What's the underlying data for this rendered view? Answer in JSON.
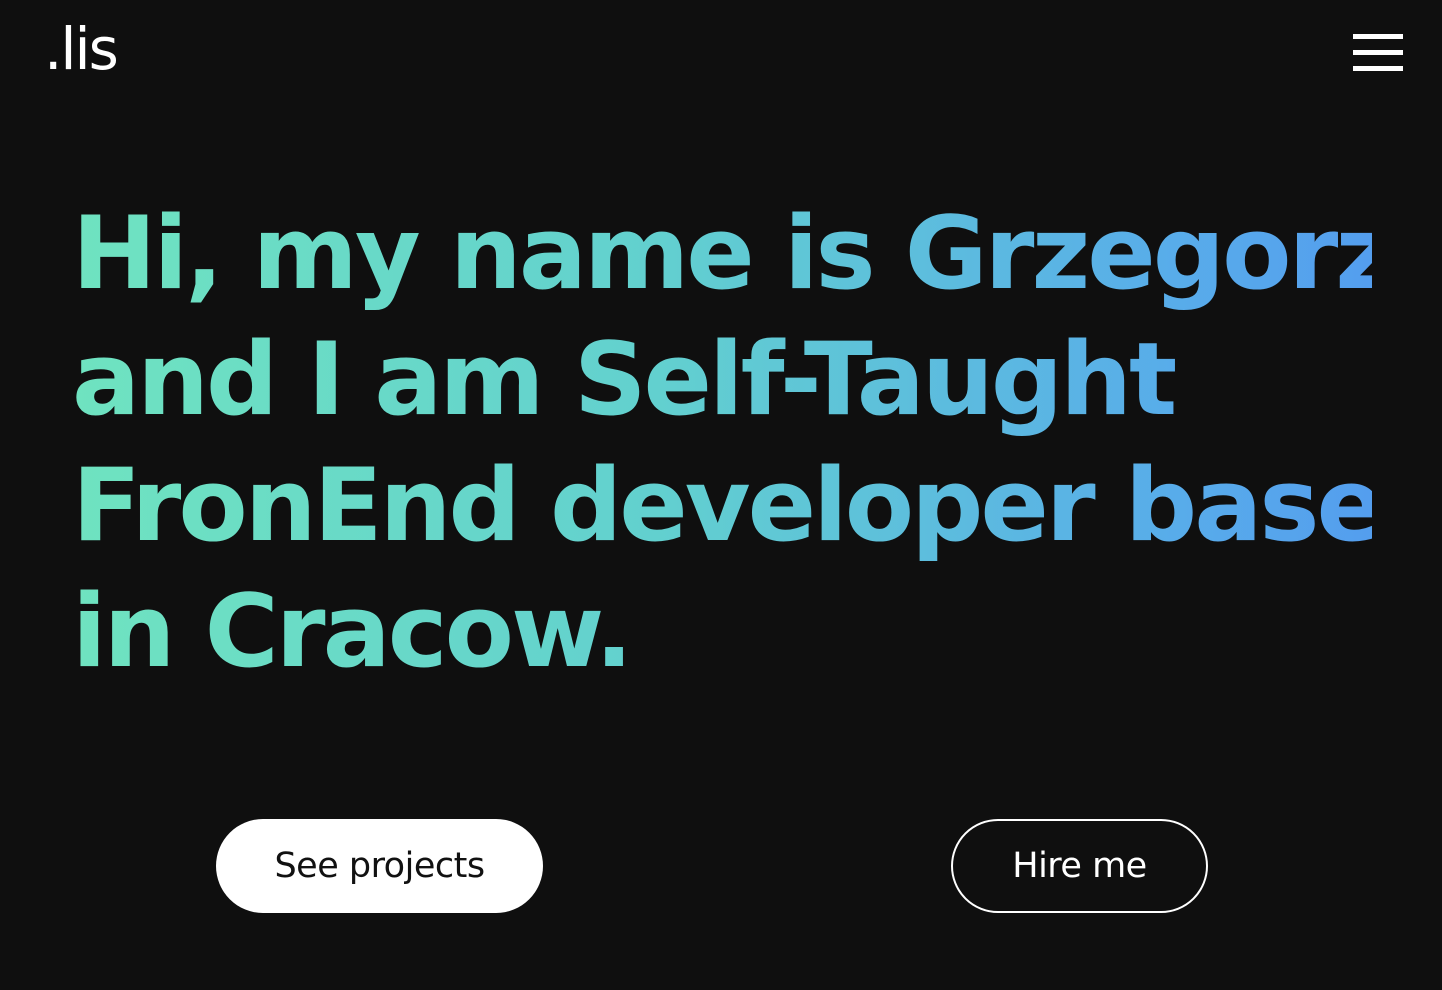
{
  "header": {
    "logo_text": ".lis",
    "menu_icon": "hamburger-menu-icon"
  },
  "hero": {
    "lines": [
      "Hi, my name is Grzegorz",
      "and I am Self-Taught",
      "FronEnd developer based",
      "in Cracow."
    ]
  },
  "actions": {
    "see_projects_label": "See projects",
    "hire_me_label": "Hire me"
  },
  "colors": {
    "background": "#0f0f0f",
    "gradient_start": "#6fe3c0",
    "gradient_end": "#549eee",
    "primary_button_bg": "#ffffff",
    "text_light": "#ffffff"
  }
}
